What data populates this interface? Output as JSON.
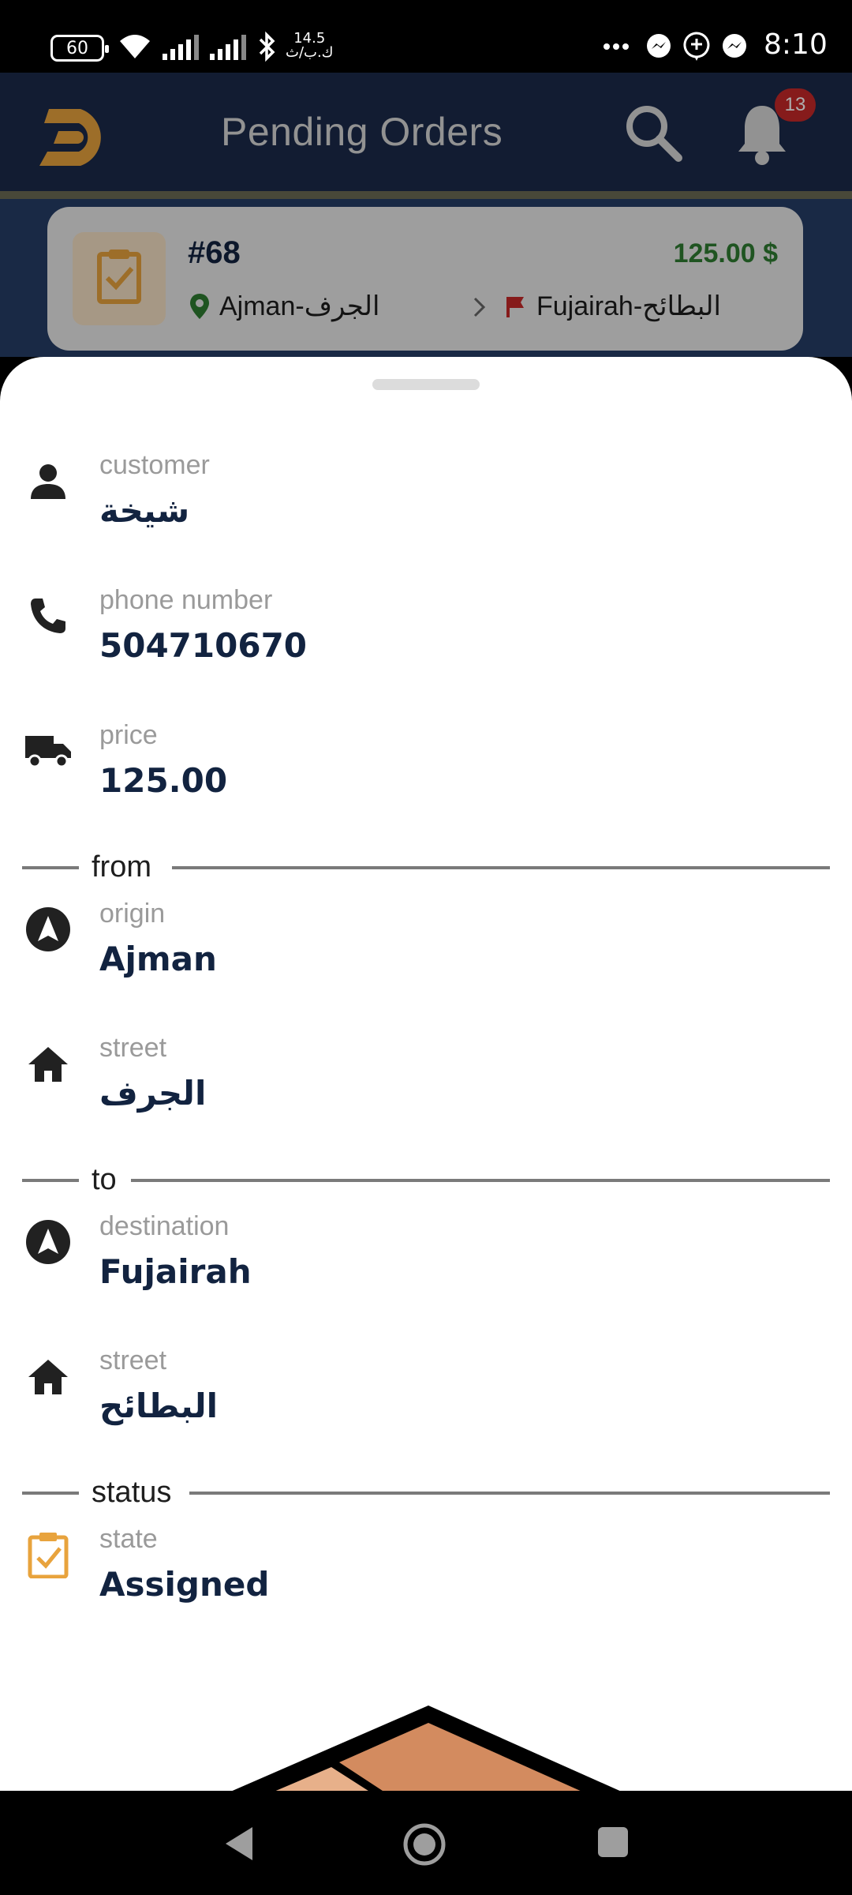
{
  "status_bar": {
    "battery": "60",
    "speed_top": "14.5",
    "speed_bottom": "ك.ب/ث",
    "time": "8:10"
  },
  "header": {
    "title": "Pending Orders",
    "notification_count": "13",
    "icons": {
      "logo": "d-logo-icon",
      "search": "search-icon",
      "bell": "bell-icon"
    }
  },
  "order_card": {
    "id": "#68",
    "price": "125.00 $",
    "from": "Ajman-الجرف",
    "to": "Fujairah-البطائح"
  },
  "details": {
    "customer": {
      "label": "customer",
      "value": "شيخة"
    },
    "phone": {
      "label": "phone number",
      "value": "504710670"
    },
    "price": {
      "label": "price",
      "value": "125.00"
    },
    "section_from": "from",
    "origin": {
      "label": "origin",
      "value": "Ajman"
    },
    "origin_street": {
      "label": "street",
      "value": "الجرف"
    },
    "section_to": "to",
    "destination": {
      "label": "destination",
      "value": "Fujairah"
    },
    "destination_street": {
      "label": "street",
      "value": "البطائح"
    },
    "section_status": "status",
    "state": {
      "label": "state",
      "value": "Assigned"
    }
  },
  "colors": {
    "header_bg": "#1b2a4a",
    "accent_orange": "#e8a33d",
    "price_green": "#2e7d32",
    "value_navy": "#122340",
    "badge_red": "#c62828"
  }
}
